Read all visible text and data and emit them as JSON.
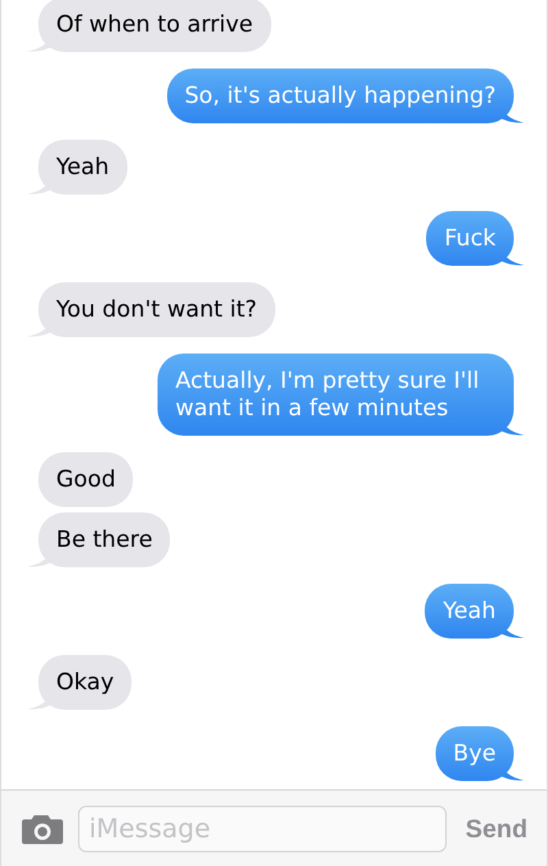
{
  "messages": [
    {
      "text": "Of when to arrive",
      "outgoing": false,
      "tail": true
    },
    {
      "text": "So, it's actually happening?",
      "outgoing": true,
      "tail": true
    },
    {
      "text": "Yeah",
      "outgoing": false,
      "tail": true
    },
    {
      "text": "Fuck",
      "outgoing": true,
      "tail": true
    },
    {
      "text": "You don't want it?",
      "outgoing": false,
      "tail": true
    },
    {
      "text": "Actually, I'm pretty sure I'll want it in a few minutes",
      "outgoing": true,
      "tail": true
    },
    {
      "text": "Good",
      "outgoing": false,
      "tail": false
    },
    {
      "text": "Be there",
      "outgoing": false,
      "tail": true
    },
    {
      "text": "Yeah",
      "outgoing": true,
      "tail": true
    },
    {
      "text": "Okay",
      "outgoing": false,
      "tail": true
    },
    {
      "text": "Bye",
      "outgoing": true,
      "tail": true
    }
  ],
  "composer": {
    "placeholder": "iMessage",
    "send": "Send"
  }
}
